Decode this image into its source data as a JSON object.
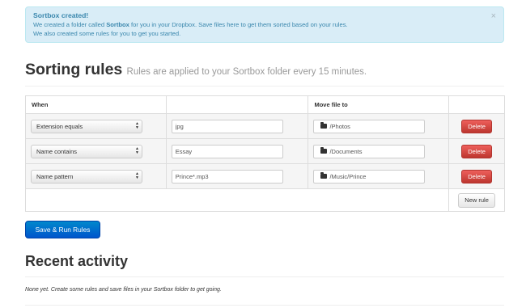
{
  "alert": {
    "title": "Sortbox created!",
    "line1_prefix": "We created a folder called ",
    "line1_bold": "Sortbox",
    "line1_suffix": " for you in your Dropbox. Save files here to get them sorted based on your rules.",
    "line2": "We also created some rules for you to get you started.",
    "close_symbol": "×"
  },
  "sorting": {
    "title": "Sorting rules",
    "subtitle": "Rules are applied to your Sortbox folder every 15 minutes."
  },
  "table": {
    "headers": [
      "When",
      "",
      "Move file to",
      ""
    ],
    "rows": [
      {
        "condition": "Extension equals",
        "value": "jpg",
        "folder": "/Photos",
        "delete_label": "Delete"
      },
      {
        "condition": "Name contains",
        "value": "Essay",
        "folder": "/Documents",
        "delete_label": "Delete"
      },
      {
        "condition": "Name pattern",
        "value": "Prince*.mp3",
        "folder": "/Music/Prince",
        "delete_label": "Delete"
      }
    ],
    "new_rule_label": "New rule"
  },
  "save_button": "Save & Run Rules",
  "recent": {
    "title": "Recent activity",
    "empty_text": "None yet. Create some rules and save files in your Sortbox folder to get going."
  },
  "icons": {
    "folder": "folder-icon",
    "select_arrows": "up-down-arrows-icon",
    "close": "close-icon"
  },
  "colors": {
    "alert_bg": "#d9edf7",
    "alert_text": "#3a87ad",
    "primary": "#0088cc",
    "danger": "#da4f49"
  }
}
